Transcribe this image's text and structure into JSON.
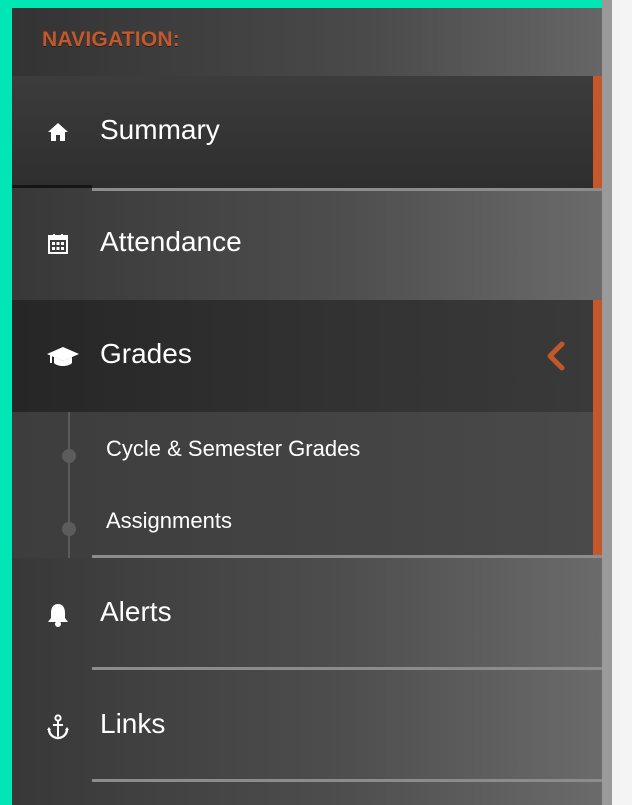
{
  "sidebar": {
    "heading": "NAVIGATION:",
    "items": [
      {
        "label": "Summary",
        "icon": "home-icon"
      },
      {
        "label": "Attendance",
        "icon": "calendar-icon"
      },
      {
        "label": "Grades",
        "icon": "graduation-cap-icon",
        "expanded": true,
        "children": [
          {
            "label": "Cycle & Semester Grades"
          },
          {
            "label": "Assignments"
          }
        ]
      },
      {
        "label": "Alerts",
        "icon": "bell-icon"
      },
      {
        "label": "Links",
        "icon": "anchor-icon"
      }
    ]
  },
  "colors": {
    "accent": "#c4582a",
    "frame": "#00e6b4",
    "text": "#ffffff"
  }
}
